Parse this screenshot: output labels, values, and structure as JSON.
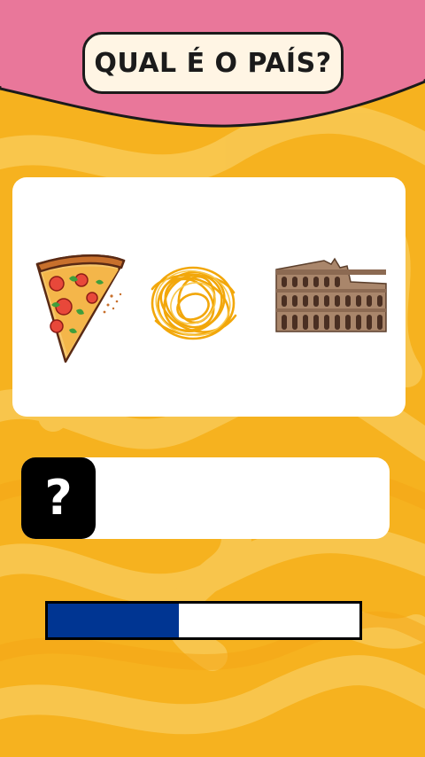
{
  "title": "QUAL É O PAÍS?",
  "colors": {
    "background": "#f6b21f",
    "background_swirl": "#f9c851",
    "header": "#e9779a",
    "progress_fill": "#003592"
  },
  "clues": [
    {
      "name": "pizza-slice"
    },
    {
      "name": "spaghetti"
    },
    {
      "name": "colosseum"
    }
  ],
  "answer": {
    "icon": "?",
    "text": ""
  },
  "progress": {
    "fraction": 0.42
  }
}
